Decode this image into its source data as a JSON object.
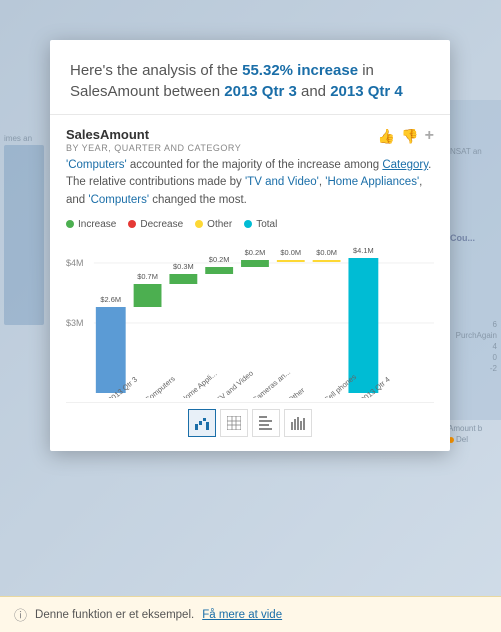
{
  "background": {
    "color": "#c8d8e8"
  },
  "card": {
    "title": "Here's the analysis of the 55.32% increase in SalesAmount between 2013 Qtr 3 and 2013 Qtr 4",
    "title_highlight": "55.32% increase",
    "chart": {
      "title": "SalesAmount",
      "subtitle": "BY YEAR, QUARTER AND CATEGORY",
      "description_part1": "'Computers' accounted for the majority of the increase among",
      "description_link": "Category",
      "description_part2": ". The relative contributions made by 'TV and Video', 'Home Appliances', and 'Computers' changed the most.",
      "legend": [
        {
          "label": "Increase",
          "color": "#4caf50"
        },
        {
          "label": "Decrease",
          "color": "#e53935"
        },
        {
          "label": "Other",
          "color": "#fdd835"
        },
        {
          "label": "Total",
          "color": "#00bcd4"
        }
      ],
      "bars": [
        {
          "label": "2013 Qtr 3",
          "value": 2.6,
          "color": "#5b9bd5",
          "valueLabel": "$2.6M",
          "type": "base"
        },
        {
          "label": "Computers",
          "value": 0.5,
          "color": "#4caf50",
          "valueLabel": "$0.7M",
          "type": "increase"
        },
        {
          "label": "Home Appli...",
          "value": 0.2,
          "color": "#4caf50",
          "valueLabel": "$0.3M",
          "type": "increase"
        },
        {
          "label": "TV and Video",
          "value": 0.15,
          "color": "#4caf50",
          "valueLabel": "$0.2M",
          "type": "increase"
        },
        {
          "label": "Cameras an...",
          "value": 0.15,
          "color": "#4caf50",
          "valueLabel": "$0.2M",
          "type": "increase"
        },
        {
          "label": "Other",
          "value": 0.0,
          "color": "#fdd835",
          "valueLabel": "$0.0M",
          "type": "other"
        },
        {
          "label": "Cell phones",
          "value": 0.0,
          "color": "#fdd835",
          "valueLabel": "$0.0M",
          "type": "other"
        },
        {
          "label": "2013 Qtr 4",
          "value": 4.1,
          "color": "#00bcd4",
          "valueLabel": "$4.1M",
          "type": "total"
        }
      ],
      "y_labels": [
        "$4M",
        "$3M"
      ],
      "actions": {
        "thumbup": "👍",
        "thumbdown": "👎",
        "expand": "+"
      },
      "toolbar": [
        {
          "label": "▦",
          "active": true,
          "name": "waterfall-chart"
        },
        {
          "label": "⊞",
          "active": false,
          "name": "table-view"
        },
        {
          "label": "▬",
          "active": false,
          "name": "bar-chart"
        },
        {
          "label": "▦",
          "active": false,
          "name": "column-chart"
        }
      ]
    }
  },
  "footer": {
    "text": "Denne funktion er et eksempel.",
    "link_text": "Få mere at vide"
  }
}
